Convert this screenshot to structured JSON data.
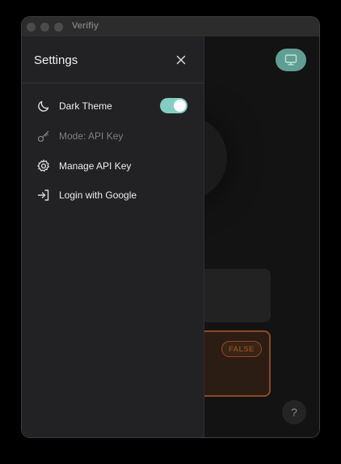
{
  "window": {
    "title": "Verifiy"
  },
  "settings": {
    "title": "Settings",
    "items": [
      {
        "icon": "moon-icon",
        "label": "Dark Theme",
        "toggle_on": true
      },
      {
        "icon": "key-icon",
        "label": "Mode: API Key",
        "disabled": true
      },
      {
        "icon": "gear-icon",
        "label": "Manage API Key"
      },
      {
        "icon": "login-icon",
        "label": "Login with Google"
      }
    ]
  },
  "background": {
    "badge_text": "FALSE",
    "help_label": "?"
  },
  "colors": {
    "accent": "#82cfc1",
    "monitor_button": "#5f9e93",
    "false_badge": "#8a4a23"
  }
}
